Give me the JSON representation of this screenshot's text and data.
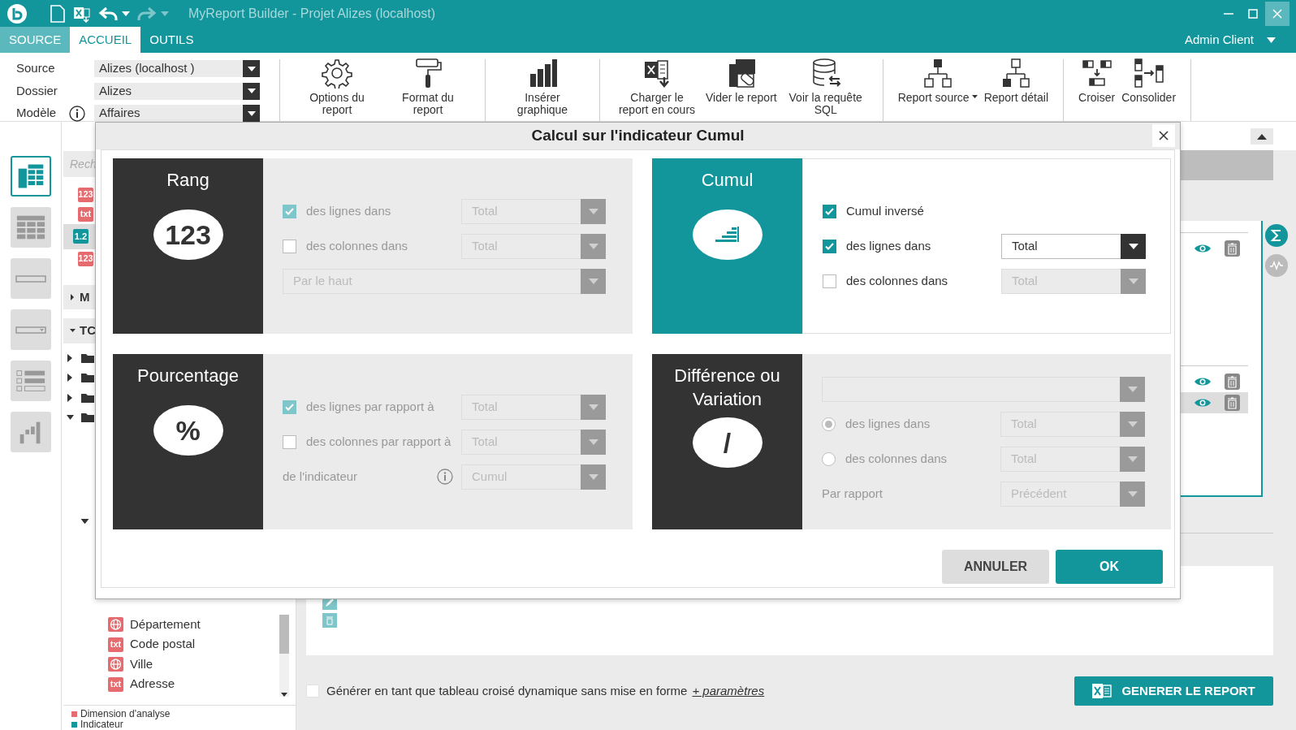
{
  "window": {
    "title": "MyReport Builder - Projet Alizes (localhost)"
  },
  "menu_tabs": [
    {
      "label": "SOURCE",
      "selected": false
    },
    {
      "label": "ACCUEIL",
      "selected": true
    },
    {
      "label": "OUTILS",
      "selected": false
    }
  ],
  "user": {
    "label": "Admin Client"
  },
  "ribbon": {
    "fields": [
      {
        "label": "Source",
        "value": "Alizes (localhost )"
      },
      {
        "label": "Dossier",
        "value": "Alizes"
      },
      {
        "label": "Modèle",
        "value": "Affaires",
        "info": true
      }
    ],
    "groups": [
      [
        {
          "label": "Options du report"
        },
        {
          "label": "Format du report"
        }
      ],
      [
        {
          "label": "Insérer graphique"
        }
      ],
      [
        {
          "label": "Charger le report en cours"
        },
        {
          "label": "Vider le report"
        },
        {
          "label": "Voir la requête SQL"
        }
      ],
      [
        {
          "label": "Report source",
          "dropdown": true
        },
        {
          "label": "Report détail"
        }
      ],
      [
        {
          "label": "Croiser"
        },
        {
          "label": "Consolider"
        }
      ]
    ]
  },
  "rail": [
    {
      "selected": true
    },
    {
      "selected": false
    },
    {
      "selected": false
    },
    {
      "selected": false
    },
    {
      "selected": false
    },
    {
      "selected": false
    }
  ],
  "left_panel": {
    "search": {
      "placeholder": "Rech"
    },
    "fields": [
      {
        "badge": "123",
        "color": "#e56b6f",
        "selected": false
      },
      {
        "badge": "txt",
        "color": "#e56b6f",
        "selected": false
      },
      {
        "badge": "1.2",
        "color": "#12969c",
        "selected": true
      },
      {
        "badge": "123",
        "color": "#e56b6f",
        "selected": false
      }
    ],
    "sections": [
      {
        "label": "M",
        "expanded": false
      },
      {
        "label": "TC",
        "expanded": true
      }
    ],
    "folders": [
      {
        "expanded": false
      },
      {
        "expanded": false
      },
      {
        "expanded": false
      },
      {
        "expanded": true
      }
    ],
    "list": [
      {
        "kind": "geo",
        "label": "Département"
      },
      {
        "kind": "text",
        "badge": "txt",
        "label": "Code postal"
      },
      {
        "kind": "geo",
        "label": "Ville"
      },
      {
        "kind": "text",
        "badge": "txt",
        "label": "Adresse"
      }
    ],
    "legend": [
      {
        "label": "Dimension d'analyse",
        "color": "#e56b6f"
      },
      {
        "label": "Indicateur",
        "color": "#12969c"
      }
    ]
  },
  "main": {
    "measure_groups": [
      [
        {
          "selected": false
        }
      ],
      [
        {
          "selected": false
        },
        {
          "selected": true
        }
      ]
    ],
    "side_tools": [
      {
        "selected": true
      },
      {
        "selected": false
      }
    ],
    "pivot": {
      "label": "Générer en tant que tableau croisé dynamique sans mise en forme",
      "checked": false
    },
    "link": "+ paramètres",
    "generate": "GENERER LE REPORT"
  },
  "dialog": {
    "title": "Calcul sur l'indicateur Cumul",
    "cards": [
      {
        "title": "Rang",
        "symbol": "123",
        "selected": false,
        "rows": [
          {
            "kind": "checkbox",
            "label": "des lignes dans",
            "checked": true,
            "value": "Total"
          },
          {
            "kind": "checkbox",
            "label": "des colonnes dans",
            "checked": false,
            "value": "Total"
          },
          {
            "kind": "select",
            "value": "Par le haut"
          }
        ]
      },
      {
        "title": "Cumul",
        "selected": true,
        "rows": [
          {
            "kind": "checkbox",
            "label": "Cumul inversé",
            "checked": true
          },
          {
            "kind": "checkbox",
            "label": "des lignes dans",
            "checked": true,
            "value": "Total"
          },
          {
            "kind": "checkbox",
            "label": "des colonnes dans",
            "checked": false,
            "value": "Total"
          }
        ]
      },
      {
        "title": "Pourcentage",
        "symbol": "%",
        "selected": false,
        "rows": [
          {
            "kind": "checkbox",
            "label": "des lignes par rapport à",
            "checked": true,
            "value": "Total"
          },
          {
            "kind": "checkbox",
            "label": "des colonnes par rapport à",
            "checked": false,
            "value": "Total"
          },
          {
            "kind": "label",
            "label": "de l'indicateur",
            "info": true,
            "value": "Cumul"
          }
        ]
      },
      {
        "title": "Différence ou Variation",
        "symbol": "/",
        "selected": false,
        "rows": [
          {
            "kind": "select"
          },
          {
            "kind": "radio",
            "label": "des lignes dans",
            "checked": true,
            "value": "Total"
          },
          {
            "kind": "radio",
            "label": "des colonnes dans",
            "checked": false,
            "value": "Total"
          },
          {
            "kind": "label",
            "label": "Par rapport",
            "value": "Précédent"
          }
        ]
      }
    ],
    "buttons": [
      {
        "label": "ANNULER",
        "kind": "secondary"
      },
      {
        "label": "OK",
        "kind": "primary"
      }
    ]
  }
}
